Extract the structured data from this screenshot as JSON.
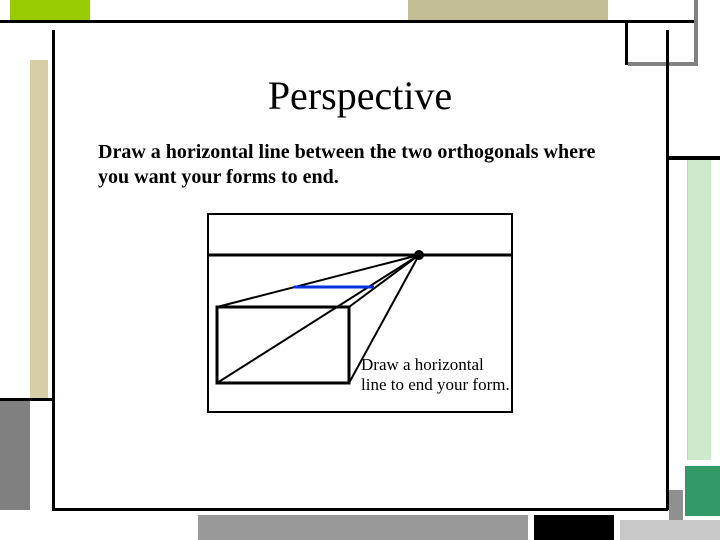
{
  "title": "Perspective",
  "body": "Draw a horizontal line between the two orthogonals where you want your forms to end.",
  "figure_caption_line1": "Draw a horizontal",
  "figure_caption_line2": "line to end your form.",
  "decor": {
    "green_tab": "#99CC00",
    "khaki_tab": "#C3BE96",
    "tan_left": "#D8CEA6",
    "gray_left": "#808080",
    "gray_bottom": "#999999",
    "black": "#000000",
    "pale_green": "#CDEACD",
    "teal": "#339966",
    "mid_gray": "#909090"
  }
}
